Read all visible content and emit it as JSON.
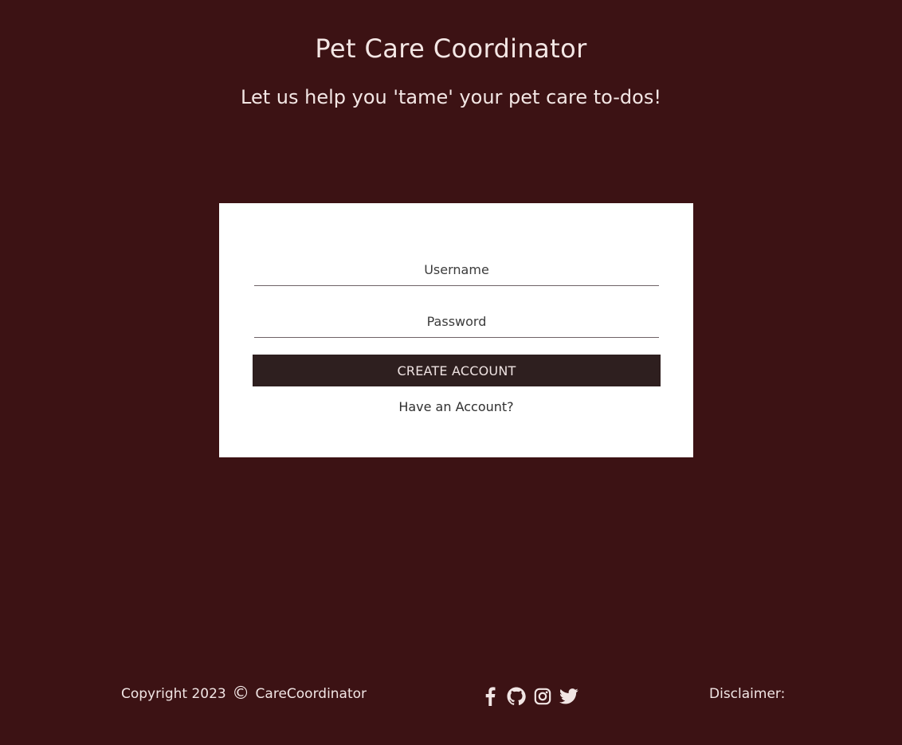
{
  "header": {
    "title": "Pet Care Coordinator",
    "tagline": "Let us help you 'tame' your pet care to-dos!"
  },
  "signup_form": {
    "username": {
      "placeholder": "Username",
      "value": ""
    },
    "password": {
      "placeholder": "Password",
      "value": ""
    },
    "create_button_label": "CREATE ACCOUNT",
    "login_link_label": "Have an Account?"
  },
  "footer": {
    "copyright_prefix": "Copyright 2023",
    "copyright_symbol": "©",
    "copyright_owner": "CareCoordinator",
    "social_icons": [
      "facebook-icon",
      "github-icon",
      "instagram-icon",
      "twitter-icon"
    ],
    "disclaimer_label": "Disclaimer:"
  },
  "colors": {
    "background": "#3c1214",
    "card": "#ffffff",
    "button": "#2e1f1f",
    "text_light": "#f1e5e4",
    "text_dark": "#2f2f2f"
  }
}
